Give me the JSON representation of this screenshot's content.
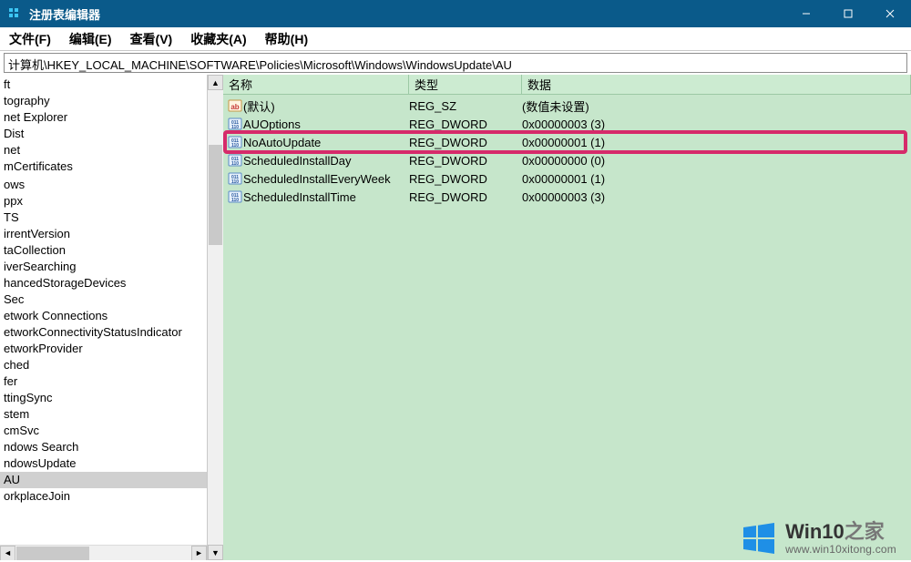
{
  "window": {
    "title": "注册表编辑器"
  },
  "menu": {
    "file": "文件(F)",
    "edit": "编辑(E)",
    "view": "查看(V)",
    "favorites": "收藏夹(A)",
    "help": "帮助(H)"
  },
  "address": "计算机\\HKEY_LOCAL_MACHINE\\SOFTWARE\\Policies\\Microsoft\\Windows\\WindowsUpdate\\AU",
  "tree": {
    "items": [
      "ft",
      "tography",
      "net Explorer",
      "Dist",
      "net",
      "mCertificates",
      "",
      "ows",
      "ppx",
      "TS",
      "irrentVersion",
      "taCollection",
      "iverSearching",
      "hancedStorageDevices",
      "Sec",
      "etwork Connections",
      "etworkConnectivityStatusIndicator",
      "etworkProvider",
      "ched",
      "fer",
      "ttingSync",
      "stem",
      "cmSvc",
      "ndows Search",
      "ndowsUpdate",
      "AU",
      "orkplaceJoin"
    ],
    "selected_index": 25
  },
  "columns": {
    "name": "名称",
    "type": "类型",
    "data": "数据"
  },
  "rows": [
    {
      "icon": "string",
      "name": "(默认)",
      "type": "REG_SZ",
      "data": "(数值未设置)",
      "highlight": false
    },
    {
      "icon": "dword",
      "name": "AUOptions",
      "type": "REG_DWORD",
      "data": "0x00000003 (3)",
      "highlight": false
    },
    {
      "icon": "dword",
      "name": "NoAutoUpdate",
      "type": "REG_DWORD",
      "data": "0x00000001 (1)",
      "highlight": true
    },
    {
      "icon": "dword",
      "name": "ScheduledInstallDay",
      "type": "REG_DWORD",
      "data": "0x00000000 (0)",
      "highlight": false
    },
    {
      "icon": "dword",
      "name": "ScheduledInstallEveryWeek",
      "type": "REG_DWORD",
      "data": "0x00000001 (1)",
      "highlight": false
    },
    {
      "icon": "dword",
      "name": "ScheduledInstallTime",
      "type": "REG_DWORD",
      "data": "0x00000003 (3)",
      "highlight": false
    }
  ],
  "watermark": {
    "brand_main": "Win10",
    "brand_sub": "之家",
    "url": "www.win10xitong.com"
  }
}
